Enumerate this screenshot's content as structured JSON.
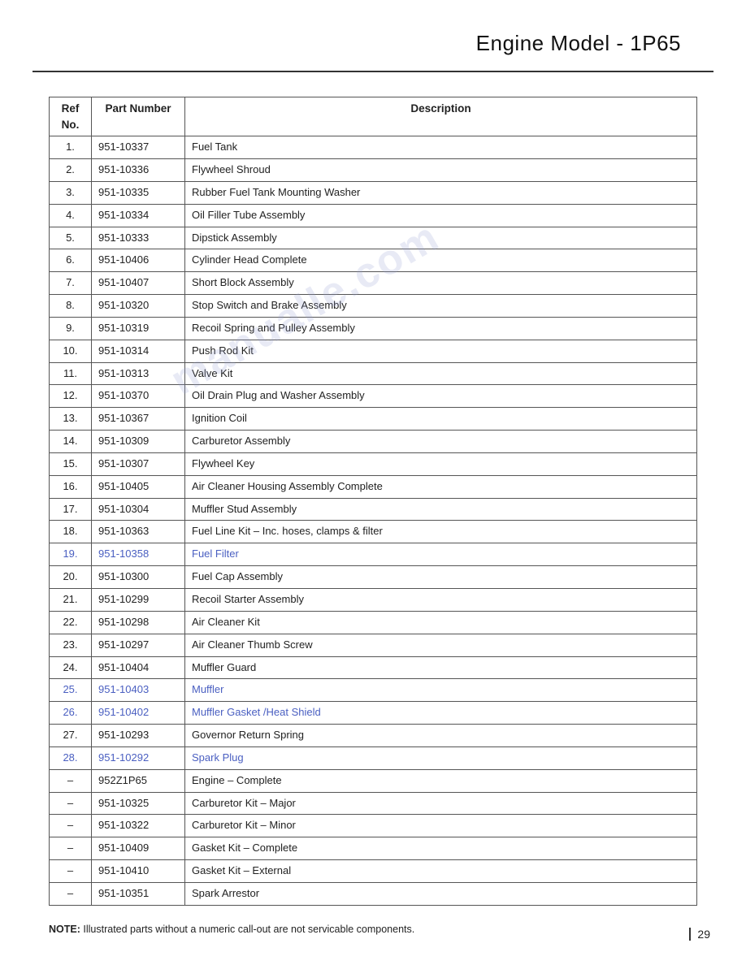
{
  "title": "Engine Model - 1P65",
  "page_number": "29",
  "watermark_text": "manualle.com",
  "table": {
    "headers": [
      "Ref No.",
      "Part Number",
      "Description"
    ],
    "rows": [
      {
        "ref": "1.",
        "part": "951-10337",
        "desc": "Fuel Tank",
        "highlight": false
      },
      {
        "ref": "2.",
        "part": "951-10336",
        "desc": "Flywheel Shroud",
        "highlight": false
      },
      {
        "ref": "3.",
        "part": "951-10335",
        "desc": "Rubber Fuel Tank Mounting Washer",
        "highlight": false
      },
      {
        "ref": "4.",
        "part": "951-10334",
        "desc": "Oil Filler Tube Assembly",
        "highlight": false
      },
      {
        "ref": "5.",
        "part": "951-10333",
        "desc": "Dipstick Assembly",
        "highlight": false
      },
      {
        "ref": "6.",
        "part": "951-10406",
        "desc": "Cylinder Head Complete",
        "highlight": false
      },
      {
        "ref": "7.",
        "part": "951-10407",
        "desc": "Short Block Assembly",
        "highlight": false
      },
      {
        "ref": "8.",
        "part": "951-10320",
        "desc": "Stop Switch and Brake Assembly",
        "highlight": false
      },
      {
        "ref": "9.",
        "part": "951-10319",
        "desc": "Recoil Spring and Pulley Assembly",
        "highlight": false
      },
      {
        "ref": "10.",
        "part": "951-10314",
        "desc": "Push Rod Kit",
        "highlight": false
      },
      {
        "ref": "11.",
        "part": "951-10313",
        "desc": "Valve Kit",
        "highlight": false
      },
      {
        "ref": "12.",
        "part": "951-10370",
        "desc": "Oil Drain Plug and Washer Assembly",
        "highlight": false
      },
      {
        "ref": "13.",
        "part": "951-10367",
        "desc": "Ignition Coil",
        "highlight": false
      },
      {
        "ref": "14.",
        "part": "951-10309",
        "desc": "Carburetor Assembly",
        "highlight": false
      },
      {
        "ref": "15.",
        "part": "951-10307",
        "desc": "Flywheel Key",
        "highlight": false
      },
      {
        "ref": "16.",
        "part": "951-10405",
        "desc": "Air Cleaner Housing Assembly Complete",
        "highlight": false
      },
      {
        "ref": "17.",
        "part": "951-10304",
        "desc": "Muffler Stud Assembly",
        "highlight": false
      },
      {
        "ref": "18.",
        "part": "951-10363",
        "desc": "Fuel Line Kit – Inc. hoses, clamps & filter",
        "highlight": false
      },
      {
        "ref": "19.",
        "part": "951-10358",
        "desc": "Fuel Filter",
        "highlight": true
      },
      {
        "ref": "20.",
        "part": "951-10300",
        "desc": "Fuel Cap Assembly",
        "highlight": false
      },
      {
        "ref": "21.",
        "part": "951-10299",
        "desc": "Recoil Starter Assembly",
        "highlight": false
      },
      {
        "ref": "22.",
        "part": "951-10298",
        "desc": "Air Cleaner Kit",
        "highlight": false
      },
      {
        "ref": "23.",
        "part": "951-10297",
        "desc": "Air Cleaner Thumb Screw",
        "highlight": false
      },
      {
        "ref": "24.",
        "part": "951-10404",
        "desc": "Muffler Guard",
        "highlight": false
      },
      {
        "ref": "25.",
        "part": "951-10403",
        "desc": "Muffler",
        "highlight": true
      },
      {
        "ref": "26.",
        "part": "951-10402",
        "desc": "Muffler Gasket /Heat Shield",
        "highlight": true
      },
      {
        "ref": "27.",
        "part": "951-10293",
        "desc": "Governor Return Spring",
        "highlight": false
      },
      {
        "ref": "28.",
        "part": "951-10292",
        "desc": "Spark Plug",
        "highlight": true
      },
      {
        "ref": "–",
        "part": "952Z1P65",
        "desc": "Engine – Complete",
        "highlight": false
      },
      {
        "ref": "–",
        "part": "951-10325",
        "desc": "Carburetor Kit – Major",
        "highlight": false
      },
      {
        "ref": "–",
        "part": "951-10322",
        "desc": "Carburetor Kit – Minor",
        "highlight": false
      },
      {
        "ref": "–",
        "part": "951-10409",
        "desc": "Gasket Kit – Complete",
        "highlight": false
      },
      {
        "ref": "–",
        "part": "951-10410",
        "desc": "Gasket Kit – External",
        "highlight": false
      },
      {
        "ref": "–",
        "part": "951-10351",
        "desc": "Spark Arrestor",
        "highlight": false
      }
    ]
  },
  "note": {
    "label": "NOTE:",
    "text": "Illustrated parts without a numeric call-out are not servicable components."
  }
}
